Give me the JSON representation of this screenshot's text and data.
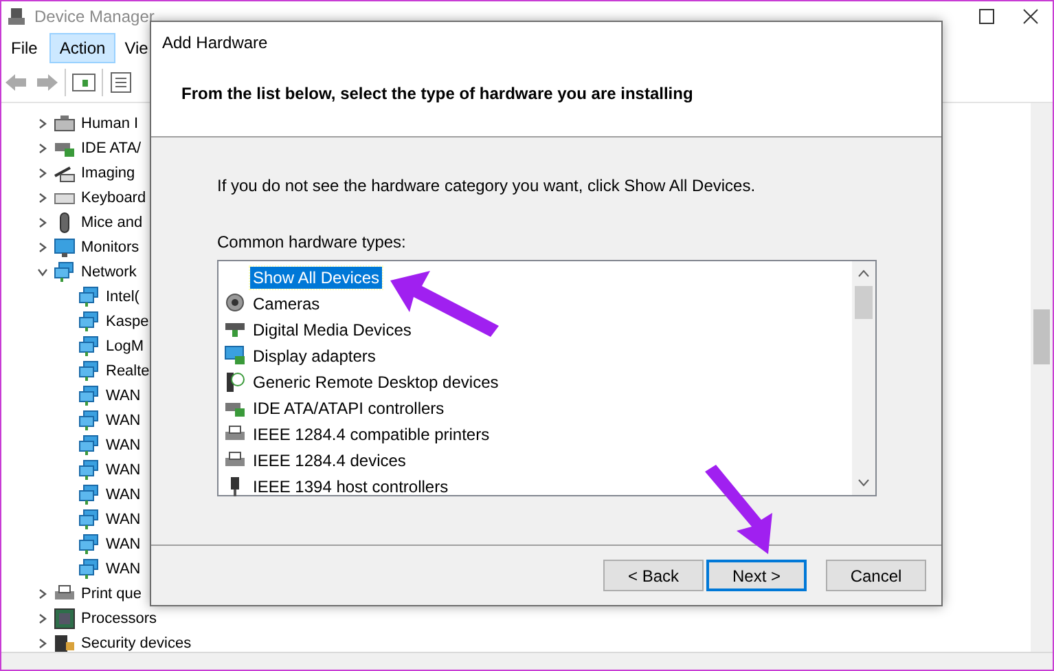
{
  "window": {
    "title": "Device Manager"
  },
  "menu": [
    {
      "label": "File",
      "selected": false
    },
    {
      "label": "Action",
      "selected": true
    },
    {
      "label": "Vie",
      "selected": false
    }
  ],
  "tree": [
    {
      "label": "Human I",
      "expanded": false
    },
    {
      "label": "IDE ATA/",
      "expanded": false
    },
    {
      "label": "Imaging",
      "expanded": false
    },
    {
      "label": "Keyboard",
      "expanded": false
    },
    {
      "label": "Mice and",
      "expanded": false
    },
    {
      "label": "Monitors",
      "expanded": false
    },
    {
      "label": "Network",
      "expanded": true,
      "children": [
        {
          "label": "Intel("
        },
        {
          "label": "Kaspe"
        },
        {
          "label": "LogM"
        },
        {
          "label": "Realte"
        },
        {
          "label": "WAN"
        },
        {
          "label": "WAN"
        },
        {
          "label": "WAN"
        },
        {
          "label": "WAN"
        },
        {
          "label": "WAN"
        },
        {
          "label": "WAN"
        },
        {
          "label": "WAN"
        },
        {
          "label": "WAN"
        }
      ]
    },
    {
      "label": "Print que",
      "expanded": false
    },
    {
      "label": "Processors",
      "expanded": false
    },
    {
      "label": "Security devices",
      "expanded": false
    }
  ],
  "dialog": {
    "title": "Add Hardware",
    "heading": "From the list below, select the type of hardware you are installing",
    "hint": "If you do not see the hardware category you want, click Show All Devices.",
    "list_label": "Common hardware types:",
    "items": [
      {
        "label": "Show All Devices",
        "selected": true
      },
      {
        "label": "Cameras",
        "selected": false
      },
      {
        "label": "Digital Media Devices",
        "selected": false
      },
      {
        "label": "Display adapters",
        "selected": false
      },
      {
        "label": "Generic Remote Desktop devices",
        "selected": false
      },
      {
        "label": "IDE ATA/ATAPI controllers",
        "selected": false
      },
      {
        "label": "IEEE 1284.4 compatible printers",
        "selected": false
      },
      {
        "label": "IEEE 1284.4 devices",
        "selected": false
      },
      {
        "label": "IEEE 1394 host controllers",
        "selected": false
      }
    ],
    "buttons": [
      {
        "label": "< Back",
        "default": false
      },
      {
        "label": "Next >",
        "default": true
      },
      {
        "label": "Cancel",
        "default": false
      }
    ]
  }
}
